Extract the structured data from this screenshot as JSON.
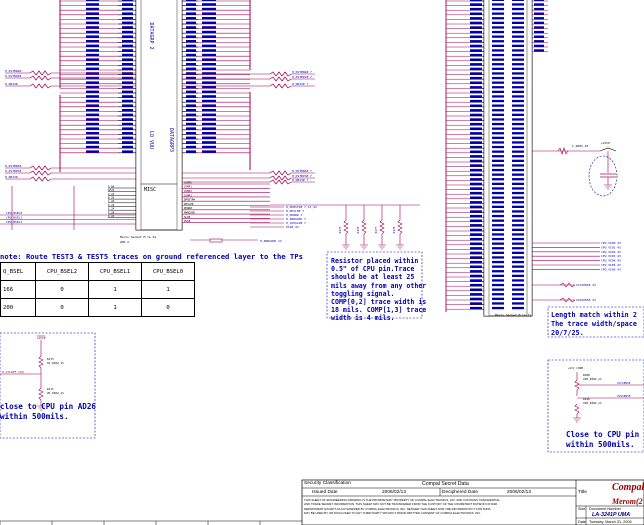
{
  "ics": {
    "dataleft_label": "DATAGRP 2",
    "datamid_label": "DATAGRP3",
    "lo_label": "LO VUU",
    "misc_label": "MISC",
    "left_part_label": "Meron Secket M le 3a",
    "left_part_ref": "AMS A",
    "right_part_label": "Meron Secket M le 3a"
  },
  "left_nets": [
    "H_DSTBN2#",
    "H_DSTBP2#",
    "H_DBI2#",
    "H_DSTBN3#",
    "H_DSTBP3#",
    "H_DBI3#"
  ],
  "right_nets": [
    "H_DSTBN2# 7",
    "H_DSTBP2# 7",
    "H_DBI2# 7",
    "H_DSTBN3# 7",
    "H_DSTBP3# 7",
    "H_DBI3# 7"
  ],
  "bsel_nets": [
    "CPU_BSEL0",
    "CPU_BSEL1",
    "CPU_BSEL2"
  ],
  "misc_pins": [
    "A_D6",
    "AF24",
    "A_24",
    "B_24",
    "C_24",
    "D_24",
    "E_24",
    "F_24",
    "G_24"
  ],
  "misc_nets": [
    "COMP0",
    "COMP1",
    "COMP2",
    "COMP3",
    "DPRSTP#",
    "DPSLP#",
    "DPWR#",
    "PWRGOOD",
    "SLP#",
    "PSI#"
  ],
  "misc_right_nets": [
    "H_DPRSTP# 7,13,43",
    "H_DPSLP# 7",
    "H_DPWR# 7",
    "H_PWRGOOD 7",
    "H_CPUSLP# 7",
    "PSI# 43"
  ],
  "pwr_net": "H_PWRGOOD 13",
  "resistor_refs": [
    "R175",
    "R176",
    "R177",
    "R178"
  ],
  "right_vcc_nets": [
    "CPU_VID0 43",
    "CPU_VID1 43",
    "CPU_VID2 43",
    "CPU_VID3 43",
    "CPU_VID4 43",
    "CPU_VID5 43",
    "CPU_VID6 43"
  ],
  "right_sense_nets": [
    "VCCSENSE 43",
    "VSSSENSE 43"
  ],
  "c_label": "C_0603_X5",
  "vccp_label": "+VCCP",
  "note_route": "note: Route TEST3 & TEST5 traces on ground referenced layer to the TPs",
  "table": {
    "headers": [
      "Q_BSEL",
      "CPU_BSEL2",
      "CPU_BSEL1",
      "CPU_BSEL0"
    ],
    "rows": [
      [
        "166",
        "0",
        "1",
        "1"
      ],
      [
        "200",
        "0",
        "1",
        "0"
      ]
    ]
  },
  "left_box": {
    "vcc": "+VCCP",
    "r1": "R133",
    "r1v": "1K_0402_1%",
    "net": "H_GTLREF_CPU",
    "r2": "R171",
    "r2v": "2K_0402_1%",
    "note": "close to CPU pin AD26\nwithin 500mils."
  },
  "right_box": {
    "vcc": "+VCC_CORE",
    "r1": "R188",
    "r1v": "100_0402_1%",
    "net": "VCCSENSE",
    "r2": "R190",
    "r2v": "100_0402_1%",
    "net2": "VSSSENSE",
    "note": "Close to CPU pin\nwithin 500mils."
  },
  "mid_note": "Resistor placed within\n0.5\" of CPU pin.Trace\nshould be at least 25\nmils away from any other\ntoggling signal.\nCOMP[0,2] trace width is\n18 mils. COMP[1,3] trace\nwidth is 4 mils.",
  "right_note": "Length match within 2\nThe trace width/space\n20/7/25.",
  "titleblock": {
    "sec_label": "Security Classification",
    "sec_value": "Compal Secret Data",
    "issued_label": "Issued Date",
    "issued_value": "2006/02/13",
    "decl_label": "Deciphered Date",
    "decl_value": "2006/02/13",
    "title_label": "Title",
    "company": "Compal",
    "product": "Merom(2",
    "size_label": "Size",
    "doc_label": "Document Number",
    "doc_value": "LA-3241P UMA",
    "date_label": "Date",
    "date_value": "Tuesday, March 31, 2006",
    "disclaimer": "THIS SHEET OF ENGINEERING DRAWING IS THE PROPRIETARY PROPERTY OF COMPAL ELECTRONICS, INC. AND CONTAINS CONFIDENTIAL\nAND TRADE SECRET INFORMATION. THIS SHEET MAY NOT BE TRANSFERED FROM THE CUSTODY OF THE COMPETENT DIVISION OF R&D\nDEPARTMENT EXCEPT AS AUTHORIZED BY COMPAL ELECTRONICS, INC. NEITHER THIS SHEET NOR THE INFORMATION IT CONTAINS\nMAY BE USED BY OR DISCLOSED TO ANY THIRD PARTY WITHOUT PRIOR WRITTEN CONSENT OF COMPAL ELECTRONICS, INC."
  },
  "colors": {
    "wire": "#a00050",
    "text": "#0000b0",
    "pin": "#000000"
  }
}
